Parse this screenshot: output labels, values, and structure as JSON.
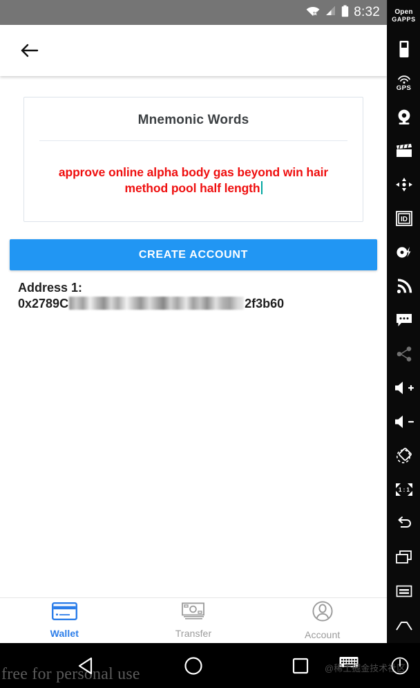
{
  "status_bar": {
    "time": "8:32",
    "icons": [
      "wifi-off-icon",
      "cellular-signal-icon",
      "battery-icon"
    ]
  },
  "app_bar": {
    "back_icon": "back-arrow-icon",
    "title": ""
  },
  "mnemonic_card": {
    "title": "Mnemonic Words",
    "words": "approve online alpha body gas beyond win hair method pool half length",
    "words_color": "#ef0f0f",
    "caret_color": "#00a6a0",
    "border_color": "#dde3ea"
  },
  "create_button": {
    "label": "CREATE ACCOUNT",
    "color": "#2196f3"
  },
  "address": {
    "label": "Address 1:",
    "prefix": "0x2789C",
    "suffix": "2f3b60",
    "redacted": true
  },
  "bottom_nav": {
    "active_color": "#2b7de9",
    "inactive_color": "#9a9a9a",
    "items": [
      {
        "label": "Wallet",
        "icon": "credit-card-icon",
        "active": true
      },
      {
        "label": "Transfer",
        "icon": "banknote-icon",
        "active": false
      },
      {
        "label": "Account",
        "icon": "person-circle-icon",
        "active": false
      }
    ]
  },
  "emulator_sidebar": {
    "logo_line1": "Open",
    "logo_line2": "GAPPS",
    "gps_label": "GPS",
    "ratio_label": "1 : 1",
    "items": [
      "battery-icon",
      "gps-icon",
      "webcam-icon",
      "clapperboard-icon",
      "dpad-icon",
      "id-badge-icon",
      "power-disc-icon",
      "signal-waves-icon",
      "sms-bubble-icon",
      "share-icon",
      "volume-up-icon",
      "volume-down-icon",
      "rotate-icon",
      "one-to-one-zoom-icon",
      "back-icon",
      "recents-icon",
      "menu-icon",
      "home-icon"
    ]
  },
  "system_nav": {
    "back_icon": "triangle-back-icon",
    "home_icon": "circle-home-icon",
    "recents_icon": "square-recents-icon",
    "keyboard_icon": "keyboard-icon",
    "power_icon": "power-icon"
  },
  "watermarks": {
    "left": "free for personal use",
    "right": "@稀土掘金技术社区"
  }
}
